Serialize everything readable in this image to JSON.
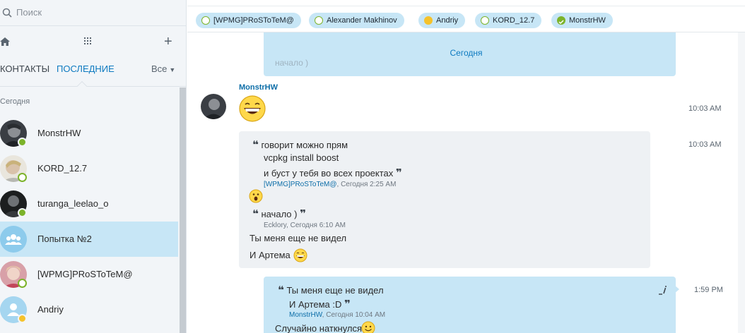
{
  "sidebar": {
    "search_placeholder": "Поиск",
    "tabs": {
      "contacts": "КОНТАКТЫ",
      "recent": "ПОСЛЕДНИЕ",
      "filter": "Все"
    },
    "section": "Сегодня",
    "contacts": [
      {
        "name": "MonstrHW",
        "status": "online",
        "avatar": "photo-dark"
      },
      {
        "name": "KORD_12.7",
        "status": "away-idle",
        "avatar": "photo-light"
      },
      {
        "name": "turanga_leelao_o",
        "status": "online",
        "avatar": "photo-dark2"
      },
      {
        "name": "Попытка №2",
        "status": "group",
        "avatar": "group-icon",
        "active": true
      },
      {
        "name": "[WPMG]PRoSToTeM@",
        "status": "away-idle",
        "avatar": "photo-pink"
      },
      {
        "name": "Andriy",
        "status": "away",
        "avatar": "default-user-icon"
      }
    ]
  },
  "participants": [
    {
      "name": "[WPMG]PRoSToTeM@",
      "status": "idle"
    },
    {
      "name": "Alexander  Makhinov",
      "status": "idle"
    },
    {
      "name": "Andriy",
      "status": "away"
    },
    {
      "name": "KORD_12.7",
      "status": "idle"
    },
    {
      "name": "MonstrHW",
      "status": "online"
    }
  ],
  "chat": {
    "earlier_faded_text": "начало )",
    "date_separator": "Сегодня",
    "sender": "MonstrHW",
    "msg1_time": "10:03 AM",
    "msg2_time": "10:03 AM",
    "quote1": {
      "lines": [
        "говорит можно прям",
        "vcpkg install boost",
        "и буст у тебя во всех проектах"
      ],
      "author": "[WPMG]PRoSToTeM@",
      "when": ", Сегодня 2:25 AM"
    },
    "quote2": {
      "text": "начало )",
      "author": "Ecklory",
      "when": ", Сегодня 6:10 AM"
    },
    "line1": "Ты меня еще не видел",
    "line2": "И Артема",
    "msg3_time": "1:59 PM",
    "quote3": {
      "lines": [
        "Ты меня еще не видел",
        "И Артема :D"
      ],
      "author": "MonstrHW",
      "when": ", Сегодня 10:04 AM"
    },
    "line3": "Случайно наткнулся"
  },
  "colors": {
    "accent": "#0d7ac0",
    "bubble_blue": "#c7e6f6",
    "bubble_gray": "#eef1f4",
    "status_online": "#7cb32a",
    "status_away": "#f5c22b"
  }
}
